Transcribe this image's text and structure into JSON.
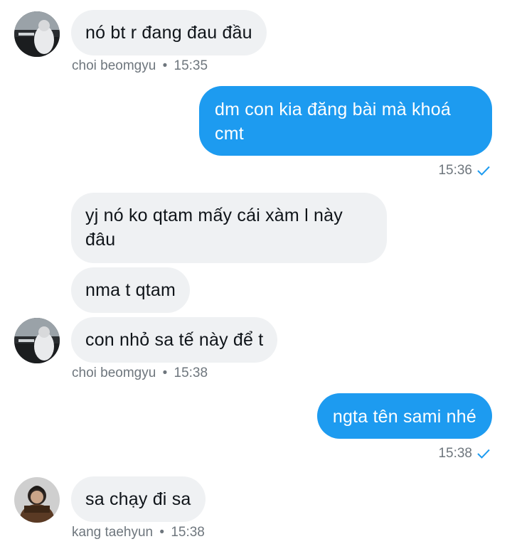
{
  "messages": [
    {
      "text": "nó bt r đang đau đầu"
    },
    {
      "text_line1": "dm con kia đăng bài mà khoá",
      "text_line2": "cmt"
    },
    {
      "text_line1": "yj nó ko qtam mấy cái xàm l này",
      "text_line2": "đâu"
    },
    {
      "text": "nma t qtam"
    },
    {
      "text": "con nhỏ sa tế này để t"
    },
    {
      "text": "ngta tên sami nhé"
    },
    {
      "text": "sa chạy đi sa"
    }
  ],
  "meta": {
    "m1": {
      "sender": "choi beomgyu",
      "time": "15:35"
    },
    "m2": {
      "time": "15:36"
    },
    "m3": {
      "sender": "choi beomgyu",
      "time": "15:38"
    },
    "m4": {
      "time": "15:38"
    },
    "m5": {
      "sender": "kang taehyun",
      "time": "15:38"
    }
  },
  "separator": "•",
  "icons": {
    "read": "checkmark-icon",
    "avatar": "avatar-photo"
  },
  "colors": {
    "outgoing": "#1d9bf0",
    "incoming": "#eff1f3",
    "meta": "#6e767d",
    "check": "#1d9bf0"
  }
}
